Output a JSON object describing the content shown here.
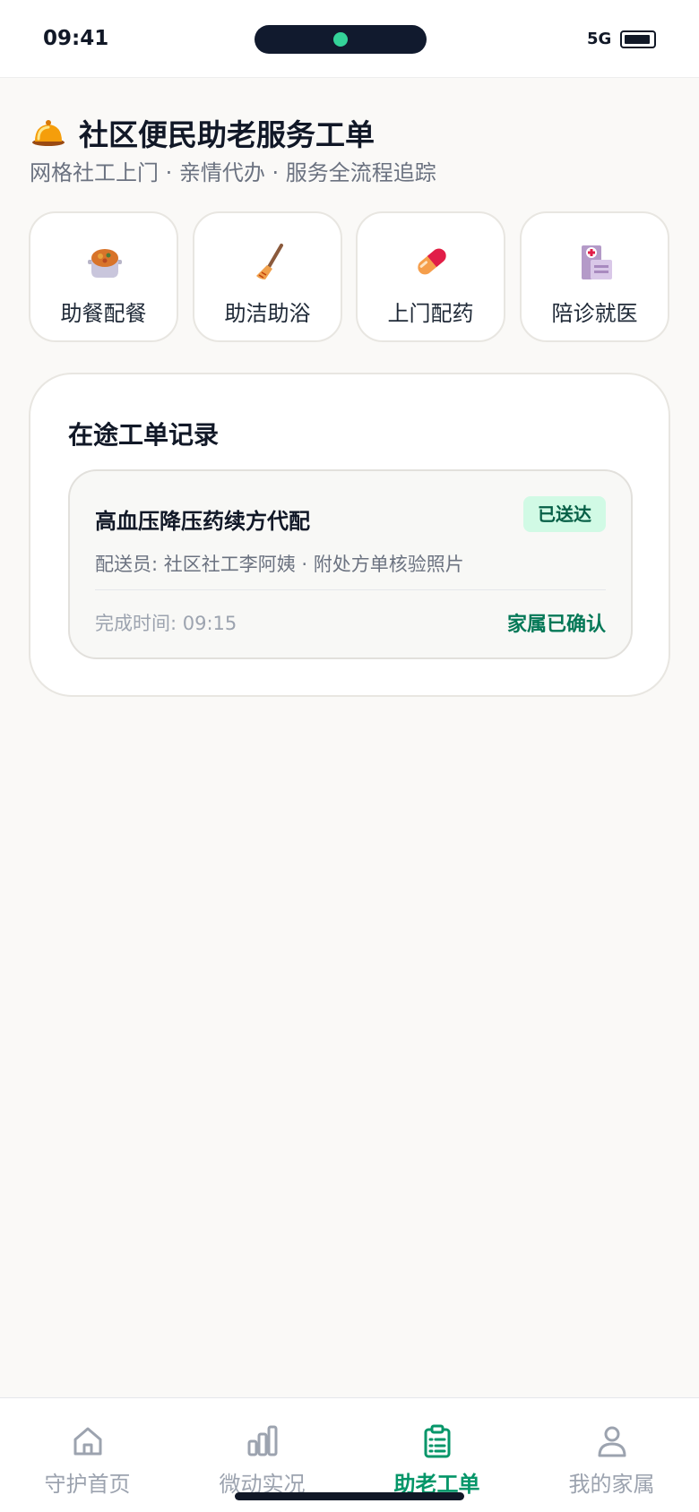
{
  "status_bar": {
    "time": "09:41",
    "network": "5G"
  },
  "header": {
    "title": "社区便民助老服务工单",
    "subtitle": "网格社工上门 · 亲情代办 · 服务全流程追踪",
    "icon": "service-bell-icon"
  },
  "services": [
    {
      "label": "助餐配餐",
      "icon": "meal-pot-icon"
    },
    {
      "label": "助洁助浴",
      "icon": "broom-icon"
    },
    {
      "label": "上门配药",
      "icon": "pill-icon"
    },
    {
      "label": "陪诊就医",
      "icon": "hospital-icon"
    }
  ],
  "records": {
    "title": "在途工单记录",
    "orders": [
      {
        "title": "高血压降压药续方代配",
        "status": "已送达",
        "meta": "配送员: 社区社工李阿姨 · 附处方单核验照片",
        "time": "完成时间: 09:15",
        "confirm": "家属已确认"
      }
    ]
  },
  "nav": {
    "items": [
      {
        "label": "守护首页",
        "icon": "home-icon",
        "active": false
      },
      {
        "label": "微动实况",
        "icon": "bar-chart-icon",
        "active": false
      },
      {
        "label": "助老工单",
        "icon": "clipboard-icon",
        "active": true
      },
      {
        "label": "我的家属",
        "icon": "person-icon",
        "active": false
      }
    ]
  },
  "colors": {
    "accent": "#059669",
    "badge_bg": "#d1fae5",
    "badge_text": "#065f46",
    "page_bg": "#faf9f7"
  }
}
